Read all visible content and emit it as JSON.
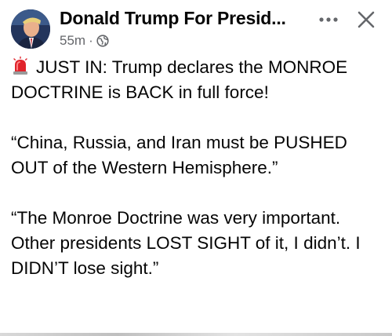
{
  "post": {
    "author": "Donald Trump For Presid...",
    "time": "55m",
    "time_separator": "·",
    "lines": [
      "JUST IN: Trump declares the MONROE DOCTRINE is BACK in full force!",
      "“China, Russia, and Iran must be PUSHED OUT of the Western Hemisphere.”",
      "“The Monroe Doctrine was very important. Other presidents LOST SIGHT of it, I didn’t. I DIDN’T lose sight.”"
    ]
  },
  "icons": {
    "avatar": "avatar",
    "globe": "globe-icon",
    "more": "more-options-icon",
    "close": "close-icon",
    "siren": "siren-icon"
  },
  "colors": {
    "text": "#050505",
    "meta": "#65676b",
    "siren_red": "#e0232b"
  }
}
